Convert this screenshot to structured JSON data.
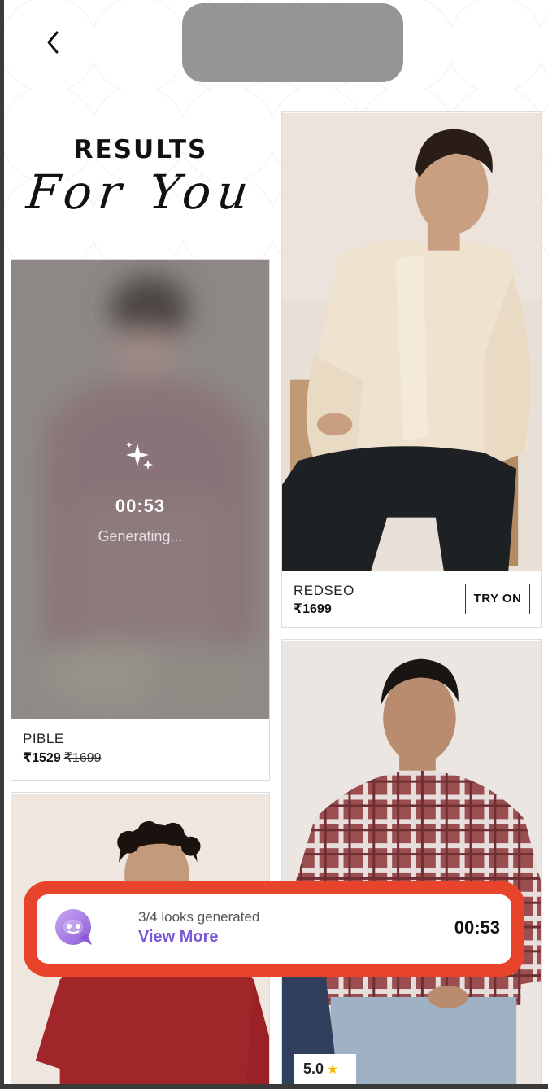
{
  "header": {
    "back_icon": "chevron-left-icon",
    "title_line1": "RESULTS",
    "title_line2": "For You"
  },
  "products": [
    {
      "brand": "PIBLE",
      "price": "₹1529",
      "mrp": "₹1699",
      "status": "Generating...",
      "timer": "00:53",
      "status_icon": "sparkle-icon"
    },
    {
      "brand": "REDSEO",
      "price": "₹1699",
      "button_label": "TRY ON"
    },
    {
      "rating": "5.0",
      "rating_icon": "star-icon"
    }
  ],
  "toast": {
    "icon": "chat-bot-icon",
    "progress_text": "3/4 looks generated",
    "link_label": "View More",
    "timer": "00:53",
    "looks_done": 3,
    "looks_total": 4
  },
  "colors": {
    "accent_purple": "#7a59d6",
    "highlight_red": "#e8442c",
    "rating_star": "#f5b800"
  }
}
